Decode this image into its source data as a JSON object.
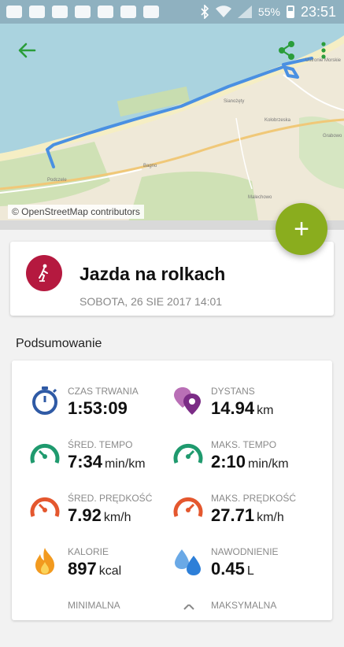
{
  "status_bar": {
    "battery": "55%",
    "time": "23:51"
  },
  "map": {
    "credit": "© OpenStreetMap contributors",
    "labels": [
      {
        "text": "Ustronie Morskie"
      },
      {
        "text": "Sianożęty"
      },
      {
        "text": "Kołobrzeska"
      },
      {
        "text": "Bagno"
      },
      {
        "text": "Podczele"
      },
      {
        "text": "Malechowo"
      },
      {
        "text": "Grabowo"
      }
    ]
  },
  "fab": {
    "label": "+"
  },
  "activity": {
    "title": "Jazda na rolkach",
    "date": "SOBOTA, 26 SIE 2017 14:01"
  },
  "summary": {
    "title": "Podsumowanie",
    "stats": [
      {
        "label": "CZAS TRWANIA",
        "value": "1:53:09",
        "unit": "",
        "icon": "stopwatch-icon"
      },
      {
        "label": "DYSTANS",
        "value": "14.94",
        "unit": "km",
        "icon": "distance-pin-icon"
      },
      {
        "label": "ŚRED. TEMPO",
        "value": "7:34",
        "unit": "min/km",
        "icon": "pace-gauge-icon"
      },
      {
        "label": "MAKS. TEMPO",
        "value": "2:10",
        "unit": "min/km",
        "icon": "pace-gauge-icon"
      },
      {
        "label": "ŚRED. PRĘDKOŚĆ",
        "value": "7.92",
        "unit": "km/h",
        "icon": "speed-gauge-icon"
      },
      {
        "label": "MAKS. PRĘDKOŚĆ",
        "value": "27.71",
        "unit": "km/h",
        "icon": "speed-gauge-icon"
      },
      {
        "label": "KALORIE",
        "value": "897",
        "unit": "kcal",
        "icon": "flame-icon"
      },
      {
        "label": "NAWODNIENIE",
        "value": "0.45",
        "unit": "L",
        "icon": "water-drops-icon"
      },
      {
        "label": "MINIMALNA",
        "value": "",
        "unit": "",
        "icon": "elevation-icon"
      },
      {
        "label": "MAKSYMALNA",
        "value": "",
        "unit": "",
        "icon": "elevation-icon"
      }
    ]
  },
  "colors": {
    "accent_green": "#8aad1e",
    "activity_red": "#b5193f",
    "route_blue": "#4a90e2",
    "toolbar_green": "#2a9d3a"
  }
}
